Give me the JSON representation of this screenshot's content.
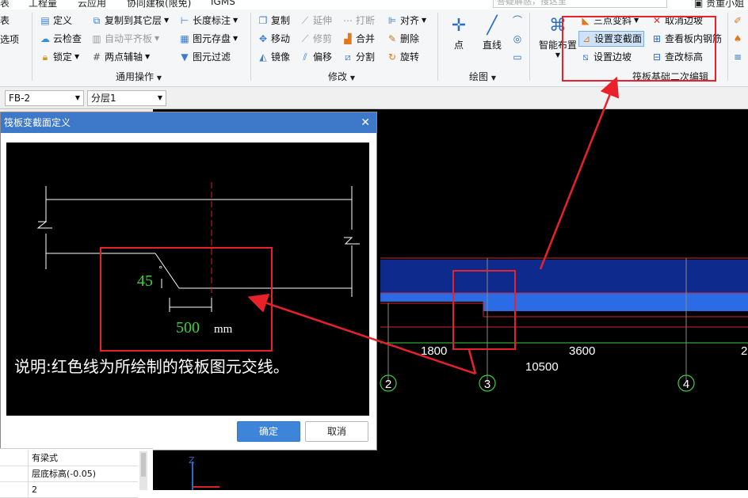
{
  "menu": {
    "items": [
      "表",
      "工程量",
      "云应用",
      "协同建模(限免)",
      "IGMS"
    ]
  },
  "search": {
    "placeholder": "答疑解惑，搜这里"
  },
  "user": {
    "name": "贵重小姐"
  },
  "ribbon": {
    "left_partial": [
      "表",
      "选项"
    ],
    "general": {
      "label": "通用操作",
      "buttons": [
        "定义",
        "云检查",
        "锁定",
        "复制到其它层",
        "自动平齐板",
        "两点辅轴",
        "长度标注",
        "图元存盘",
        "图元过滤"
      ]
    },
    "modify": {
      "label": "修改",
      "buttons": [
        "复制",
        "移动",
        "镜像",
        "延伸",
        "修剪",
        "偏移",
        "打断",
        "合并",
        "分割",
        "对齐",
        "删除",
        "旋转"
      ]
    },
    "draw": {
      "label": "绘图",
      "buttons": [
        "点",
        "直线"
      ]
    },
    "smart": {
      "label": "智能布置"
    },
    "raft": {
      "label": "筏板基础二次编辑",
      "buttons": [
        "三点变斜",
        "设置变截面",
        "设置边坡",
        "取消边坡",
        "查看板内钢筋",
        "查改标高"
      ]
    }
  },
  "toolbar2": {
    "component": "FB-2",
    "layer": "分层1"
  },
  "dialog": {
    "title": "筏板变截面定义",
    "angle": "45",
    "angle_unit": "°",
    "width": "500",
    "width_unit": "mm",
    "note": "说明:红色线为所绘制的筏板图元交线。",
    "ok": "确定",
    "cancel": "取消"
  },
  "properties": [
    {
      "value": "有梁式"
    },
    {
      "value": "层底标高(-0.05)"
    },
    {
      "value": "2"
    }
  ],
  "plan": {
    "dims": [
      "1800",
      "3600",
      "2",
      "10500"
    ],
    "axes": [
      "2",
      "3",
      "4"
    ]
  },
  "colors": {
    "annotation": "#e8212a",
    "slab": "#0e2a8c",
    "slab_step": "#2c6be6",
    "dim_green": "#3bd13b",
    "dialog_title": "#3e78c9"
  }
}
